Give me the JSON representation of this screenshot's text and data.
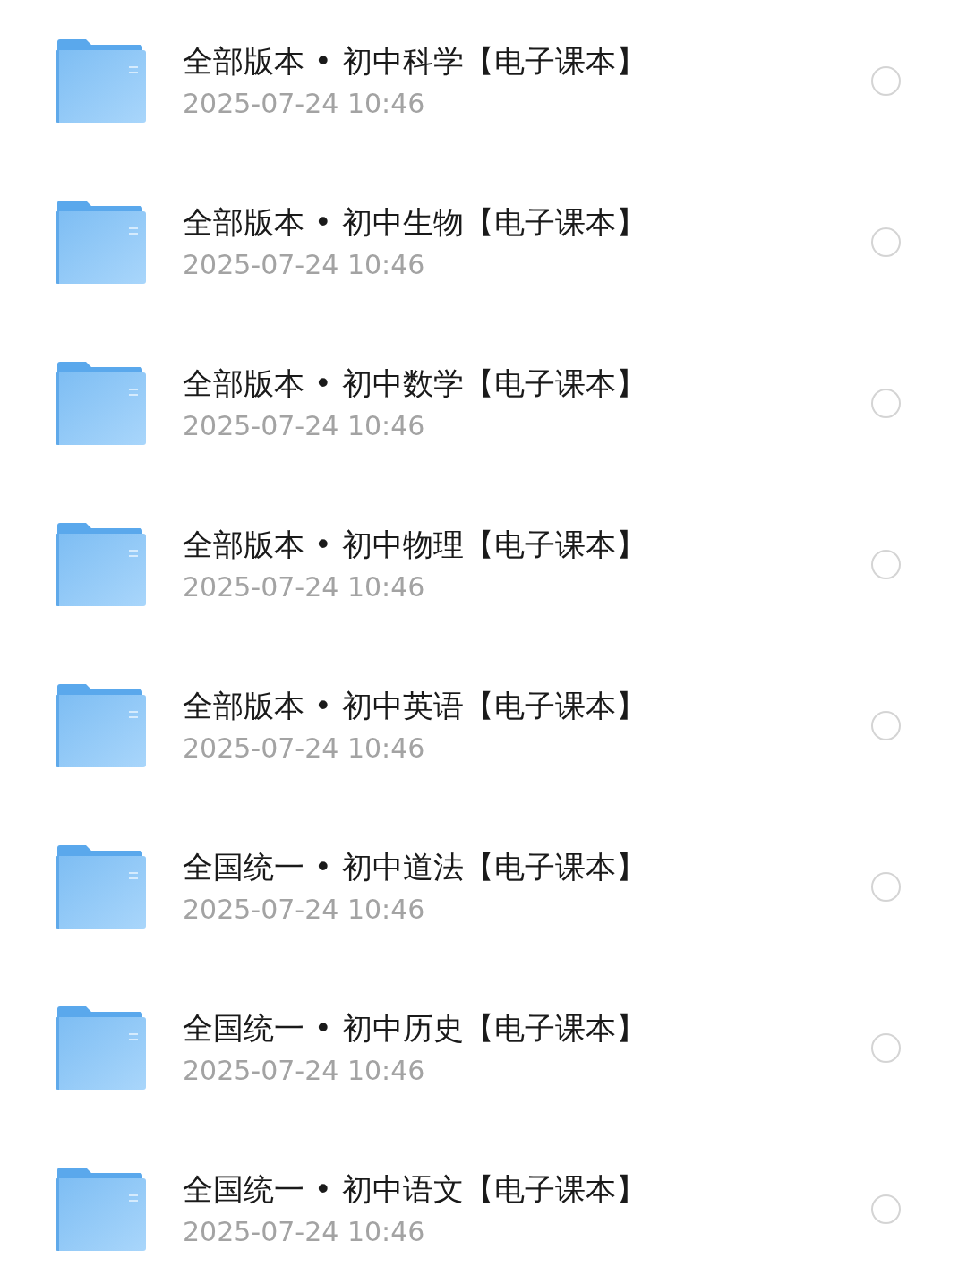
{
  "files": [
    {
      "title": "全部版本 • 初中科学【电子课本】",
      "date": "2025-07-24 10:46",
      "selected": false
    },
    {
      "title": "全部版本 • 初中生物【电子课本】",
      "date": "2025-07-24 10:46",
      "selected": false
    },
    {
      "title": "全部版本 • 初中数学【电子课本】",
      "date": "2025-07-24 10:46",
      "selected": false
    },
    {
      "title": "全部版本 • 初中物理【电子课本】",
      "date": "2025-07-24 10:46",
      "selected": false
    },
    {
      "title": "全部版本 • 初中英语【电子课本】",
      "date": "2025-07-24 10:46",
      "selected": false
    },
    {
      "title": "全国统一 • 初中道法【电子课本】",
      "date": "2025-07-24 10:46",
      "selected": false
    },
    {
      "title": "全国统一 • 初中历史【电子课本】",
      "date": "2025-07-24 10:46",
      "selected": false
    },
    {
      "title": "全国统一 • 初中语文【电子课本】",
      "date": "2025-07-24 10:46",
      "selected": false
    }
  ]
}
